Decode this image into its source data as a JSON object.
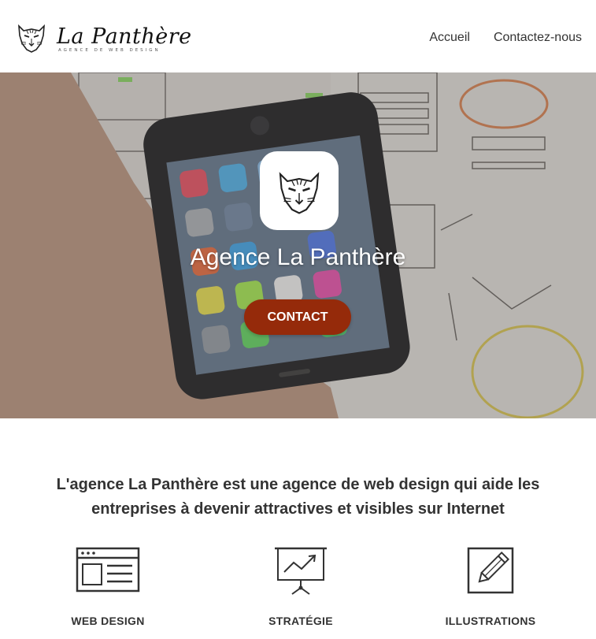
{
  "header": {
    "logo_name": "La Panthère",
    "logo_tagline": "AGENCE DE WEB DESIGN",
    "nav": [
      {
        "label": "Accueil"
      },
      {
        "label": "Contactez-nous"
      }
    ]
  },
  "hero": {
    "title": "Agence La Panthère",
    "button_label": "CONTACT",
    "button_color": "#952a0a"
  },
  "intro": {
    "text": "L'agence La Panthère est une agence de web design qui aide les entreprises à devenir attractives et visibles sur Internet"
  },
  "features": [
    {
      "label": "WEB DESIGN",
      "icon": "browser-window-icon"
    },
    {
      "label": "STRATÉGIE",
      "icon": "presentation-chart-icon"
    },
    {
      "label": "ILLUSTRATIONS",
      "icon": "pencil-icon"
    }
  ]
}
